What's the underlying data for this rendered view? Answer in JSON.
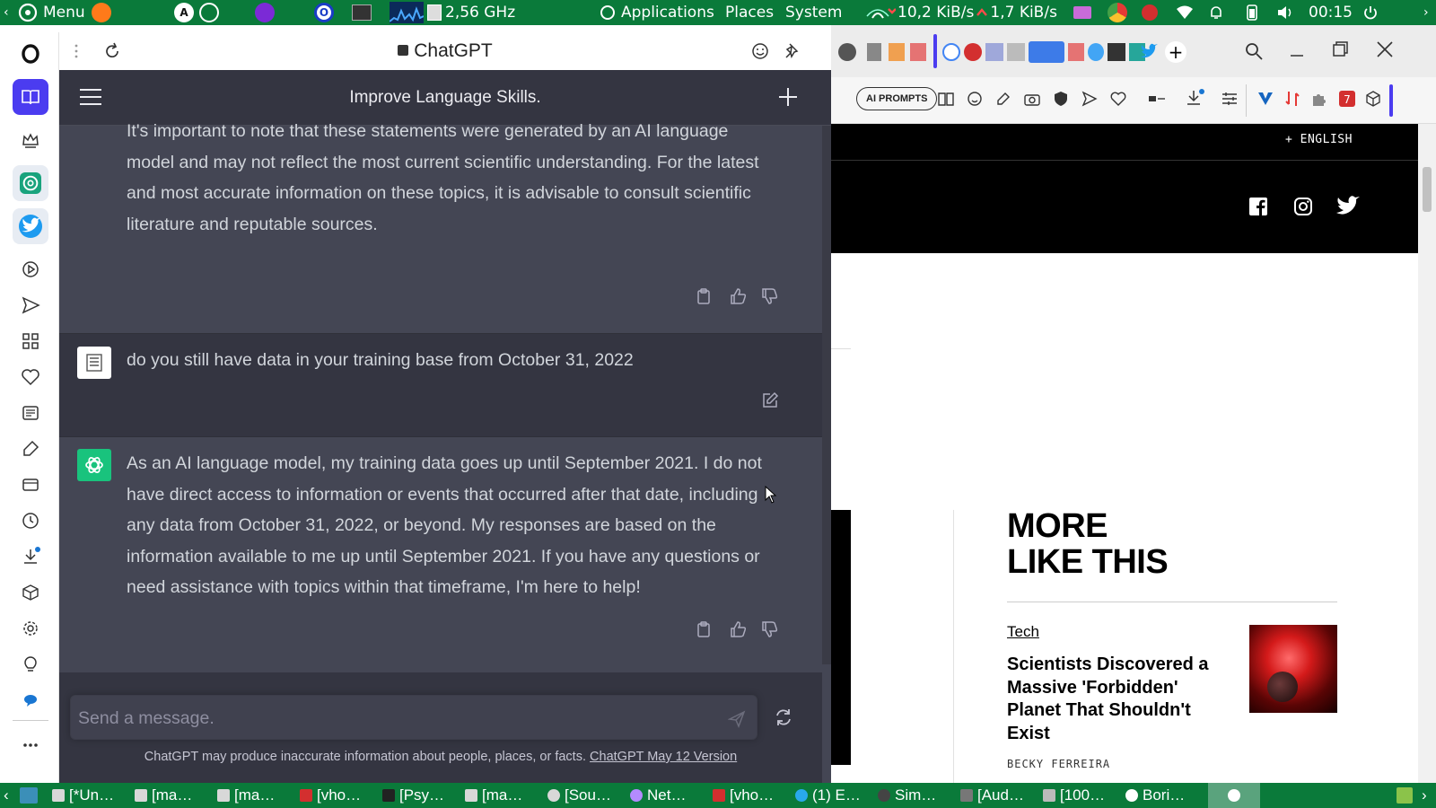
{
  "top_panel": {
    "menu_label": "Menu",
    "cpu_freq": "2,56 GHz",
    "applications": "Applications",
    "places": "Places",
    "system": "System",
    "net_down": "10,2 KiB/s",
    "net_up": "1,7 KiB/s",
    "clock": "00:15"
  },
  "chat_panel": {
    "address_title": "ChatGPT",
    "header_title": "Improve Language Skills.",
    "messages": [
      {
        "role": "assistant",
        "lines": [
          "It's important to note that these statements were generated by an AI language",
          "model and may not reflect the most current scientific understanding. For the latest",
          "and most accurate information on these topics, it is advisable to consult scientific",
          "literature and reputable sources."
        ]
      },
      {
        "role": "user",
        "lines": [
          "do you still have data in your training base from October 31, 2022"
        ]
      },
      {
        "role": "assistant",
        "lines": [
          "As an AI language model, my training data goes up until September 2021. I do not",
          "have direct access to information or events that occurred after that date, including",
          "any data from October 31, 2022, or beyond. My responses are based on the",
          "information available to me up until September 2021. If you have any questions or",
          "need assistance with topics within that timeframe, I'm here to help!"
        ]
      }
    ],
    "input_placeholder": "Send a message.",
    "footer_text": "ChatGPT may produce inaccurate information about people, places, or facts.",
    "footer_link": "ChatGPT May 12 Version"
  },
  "browser": {
    "ai_prompts_label": "AI PROMPTS",
    "language_label": "+ ENGLISH",
    "more_like_this_line1": "MORE",
    "more_like_this_line2": "LIKE THIS",
    "article_category": "Tech",
    "article_title": "Scientists Discovered a Massive 'Forbidden' Planet That Shouldn't Exist",
    "article_author": "BECKY FERREIRA"
  },
  "taskbar": {
    "items": [
      "[*Un…",
      "[ma…",
      "[ma…",
      "[vho…",
      "[Psy…",
      "[ma…",
      "[Sou…",
      "Net…",
      "[vho…",
      "(1) E…",
      "Sim…",
      "[Aud…",
      "[100…",
      "Bori…"
    ]
  },
  "colors": {
    "panel_green": "#0a7a3a",
    "chat_dark": "#343541",
    "chat_light": "#444654",
    "gpt_green": "#19c37d",
    "opera_accent": "#4b3cf0"
  }
}
